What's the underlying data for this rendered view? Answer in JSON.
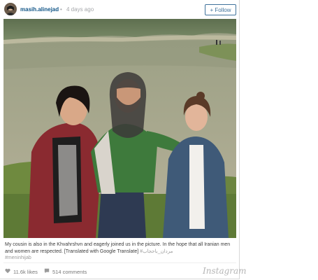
{
  "post": {
    "username": "masih.alinejad",
    "separator": "•",
    "time": "4 days ago",
    "follow_label": "+ Follow",
    "caption_text": "My cousin is also in the Khvahrshvn and eagerly joined us in the picture. In the hope that all Iranian men and women are respected. [Translated with Google Translate]",
    "caption_tag_1": "#مردان_باحجاب",
    "caption_tag_2": "#meninhijab",
    "likes": "11.6k likes",
    "comments": "514 comments",
    "brand": "Instagram"
  },
  "colors": {
    "link": "#125688",
    "follow": "#3f729b",
    "muted": "#a5a7aa"
  },
  "icons": {
    "avatar": "profile-photo",
    "likes": "heart-icon",
    "comments": "comment-bubble-icon"
  }
}
